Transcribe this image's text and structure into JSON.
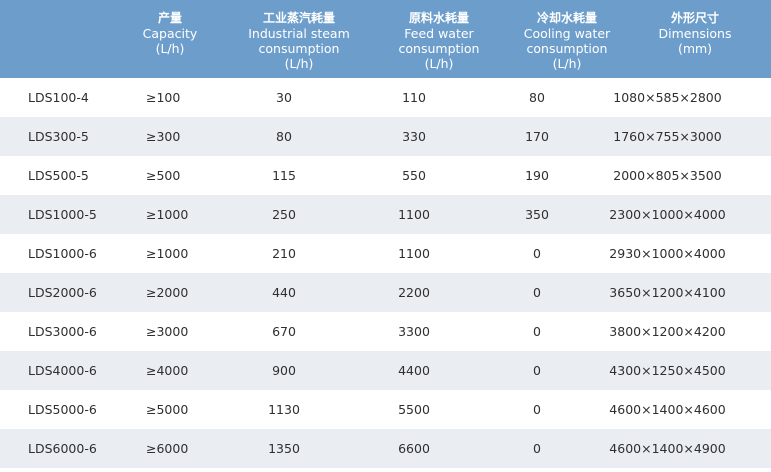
{
  "table": {
    "headers": [
      {
        "key": "cap",
        "zh": "产量",
        "en1": "Capacity",
        "en2": "",
        "unit": "(L/h)"
      },
      {
        "key": "steam",
        "zh": "工业蒸汽耗量",
        "en1": "Industrial steam",
        "en2": "consumption",
        "unit": "(L/h)"
      },
      {
        "key": "feed",
        "zh": "原料水耗量",
        "en1": "Feed water",
        "en2": "consumption",
        "unit": "(L/h)"
      },
      {
        "key": "cool",
        "zh": "冷却水耗量",
        "en1": "Cooling water",
        "en2": "consumption",
        "unit": "(L/h)"
      },
      {
        "key": "dim",
        "zh": "外形尺寸",
        "en1": "Dimensions",
        "en2": "",
        "unit": "(mm)"
      }
    ],
    "rows": [
      {
        "model": "LDS100-4",
        "capacity": "≥100",
        "steam": "30",
        "feed": "110",
        "cooling": "80",
        "dimensions": "1080×585×2800"
      },
      {
        "model": "LDS300-5",
        "capacity": "≥300",
        "steam": "80",
        "feed": "330",
        "cooling": "170",
        "dimensions": "1760×755×3000"
      },
      {
        "model": "LDS500-5",
        "capacity": "≥500",
        "steam": "115",
        "feed": "550",
        "cooling": "190",
        "dimensions": "2000×805×3500"
      },
      {
        "model": "LDS1000-5",
        "capacity": "≥1000",
        "steam": "250",
        "feed": "1100",
        "cooling": "350",
        "dimensions": "2300×1000×4000"
      },
      {
        "model": "LDS1000-6",
        "capacity": "≥1000",
        "steam": "210",
        "feed": "1100",
        "cooling": "0",
        "dimensions": "2930×1000×4000"
      },
      {
        "model": "LDS2000-6",
        "capacity": "≥2000",
        "steam": "440",
        "feed": "2200",
        "cooling": "0",
        "dimensions": "3650×1200×4100"
      },
      {
        "model": "LDS3000-6",
        "capacity": "≥3000",
        "steam": "670",
        "feed": "3300",
        "cooling": "0",
        "dimensions": "3800×1200×4200"
      },
      {
        "model": "LDS4000-6",
        "capacity": "≥4000",
        "steam": "900",
        "feed": "4400",
        "cooling": "0",
        "dimensions": "4300×1250×4500"
      },
      {
        "model": "LDS5000-6",
        "capacity": "≥5000",
        "steam": "1130",
        "feed": "5500",
        "cooling": "0",
        "dimensions": "4600×1400×4600"
      },
      {
        "model": "LDS6000-6",
        "capacity": "≥6000",
        "steam": "1350",
        "feed": "6600",
        "cooling": "0",
        "dimensions": "4600×1400×4900"
      }
    ]
  },
  "colors": {
    "header_bg": "#6d9ecb",
    "row_alt": "#eaeef3",
    "text": "#2f2f2f"
  }
}
